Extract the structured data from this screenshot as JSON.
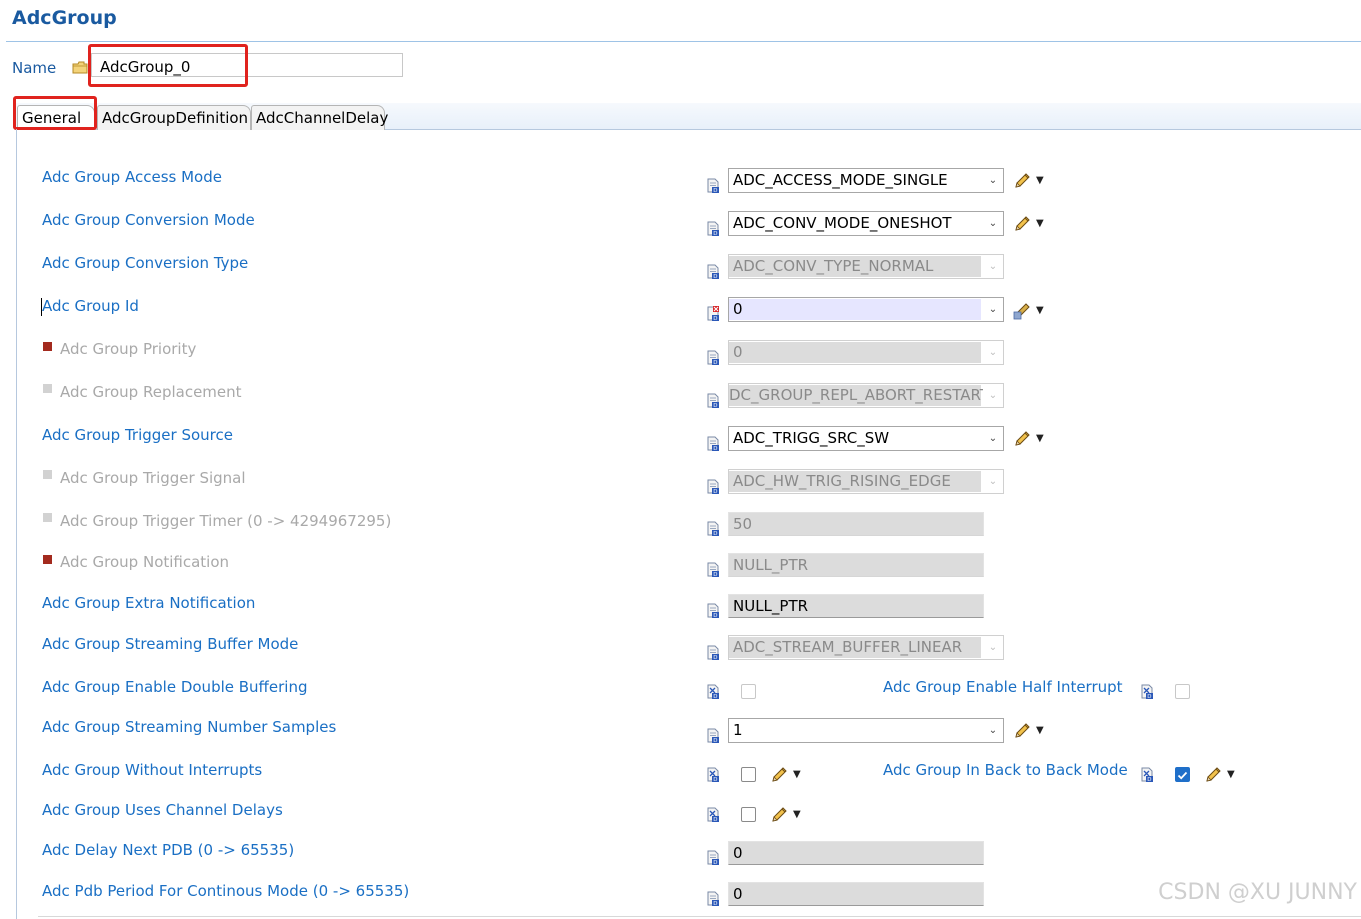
{
  "header": {
    "title": "AdcGroup",
    "name_label": "Name",
    "name_value": "AdcGroup_0"
  },
  "tabs": [
    {
      "label": "General",
      "active": true
    },
    {
      "label": "AdcGroupDefinition",
      "active": false
    },
    {
      "label": "AdcChannelDelay",
      "active": false
    }
  ],
  "fields": {
    "access_mode": {
      "label": "Adc Group Access Mode",
      "value": "ADC_ACCESS_MODE_SINGLE"
    },
    "conversion_mode": {
      "label": "Adc Group Conversion Mode",
      "value": "ADC_CONV_MODE_ONESHOT"
    },
    "conversion_type": {
      "label": "Adc Group Conversion Type",
      "value": "ADC_CONV_TYPE_NORMAL"
    },
    "group_id": {
      "label": "Adc Group Id",
      "value": "0"
    },
    "priority": {
      "label": "Adc Group Priority",
      "value": "0"
    },
    "replacement": {
      "label": "Adc Group Replacement",
      "value": "DC_GROUP_REPL_ABORT_RESTART"
    },
    "trigger_source": {
      "label": "Adc Group Trigger Source",
      "value": "ADC_TRIGG_SRC_SW"
    },
    "trigger_signal": {
      "label": "Adc Group Trigger Signal",
      "value": "ADC_HW_TRIG_RISING_EDGE"
    },
    "trigger_timer": {
      "label": "Adc Group Trigger Timer (0 -> 4294967295)",
      "value": "50"
    },
    "notification": {
      "label": "Adc Group Notification",
      "value": "NULL_PTR"
    },
    "extra_notification": {
      "label": "Adc Group Extra Notification",
      "value": "NULL_PTR"
    },
    "streaming_buffer_mode": {
      "label": "Adc Group Streaming Buffer Mode",
      "value": "ADC_STREAM_BUFFER_LINEAR"
    },
    "enable_double_buffering": {
      "label": "Adc Group Enable Double Buffering",
      "checked": false
    },
    "enable_half_interrupt": {
      "label": "Adc Group Enable Half Interrupt",
      "checked": false
    },
    "streaming_number_samples": {
      "label": "Adc Group Streaming Number Samples",
      "value": "1"
    },
    "without_interrupts": {
      "label": "Adc Group Without Interrupts",
      "checked": false
    },
    "back_to_back_mode": {
      "label": "Adc Group In Back to Back Mode",
      "checked": true
    },
    "uses_channel_delays": {
      "label": "Adc Group Uses Channel Delays",
      "checked": false
    },
    "delay_next_pdb": {
      "label": "Adc Delay Next PDB (0 -> 65535)",
      "value": "0"
    },
    "pdb_period": {
      "label": "Adc Pdb Period For Continous Mode (0 -> 65535)",
      "value": "0"
    }
  },
  "watermark": "CSDN @XU JUNNY",
  "colors": {
    "label_blue": "#1a6fc4",
    "title_blue": "#1a5aa0",
    "highlight_red": "#e0231e",
    "check_blue": "#1f6fc9"
  },
  "icons": [
    "folder-icon",
    "field-info-icon",
    "pencil-edit-icon",
    "dropdown-arrow-icon",
    "checkbox-icon"
  ]
}
